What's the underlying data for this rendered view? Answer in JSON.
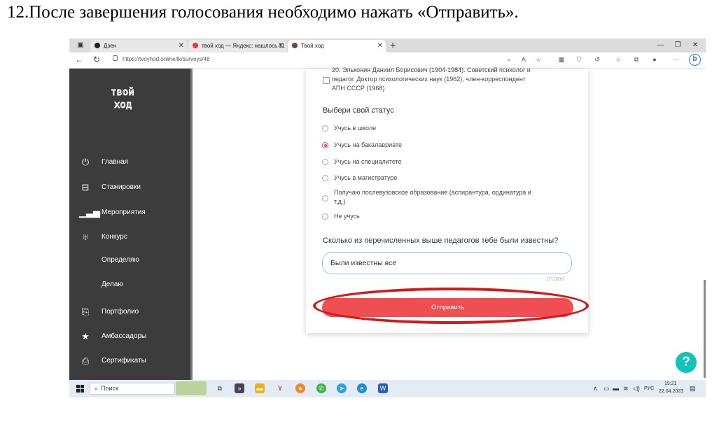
{
  "instruction": "12.После завершения голосования необходимо нажать «Отправить».",
  "browser": {
    "tabs": [
      {
        "title": "Дзен"
      },
      {
        "title": "твой ход — Яндекс: нашлось 11"
      },
      {
        "title": "Твой ход"
      }
    ],
    "url": "https://tvoyhod.online/lk/surveys/48"
  },
  "sidebar": {
    "logo_line1": "твой",
    "logo_line2": "ход",
    "items": [
      {
        "label": "Главная",
        "icon": "power-icon"
      },
      {
        "label": "Стажировки",
        "icon": "briefcase-icon"
      },
      {
        "label": "Мероприятия",
        "icon": "bars-icon"
      },
      {
        "label": "Конкурс",
        "icon": "trophy-icon"
      },
      {
        "label": "Определяю",
        "icon": ""
      },
      {
        "label": "Делаю",
        "icon": ""
      },
      {
        "label": "Портфолио",
        "icon": "portfolio-icon"
      },
      {
        "label": "Амбассадоры",
        "icon": "star-icon"
      },
      {
        "label": "Сертификаты",
        "icon": "certificate-icon"
      }
    ]
  },
  "survey": {
    "prev_option_line1": "20. Эльконин Даниил Борисович (1904-1984). Советский психолог и",
    "prev_option_line2": "педагог. Доктор психологических наук (1962), член-корреспондент",
    "prev_option_line3": "АПН СССР (1968)",
    "status_question": "Выбери свой статус",
    "status_options": [
      {
        "label": "Учусь в школе",
        "selected": false
      },
      {
        "label": "Учусь на бакалавриате",
        "selected": true
      },
      {
        "label": "Учусь на специалитете",
        "selected": false
      },
      {
        "label": "Учусь в магистратуре",
        "selected": false
      },
      {
        "label_line1": "Получаю послевузовское образование (аспирантура, ординатура и",
        "label_line2": "т.д.)",
        "selected": false
      },
      {
        "label": "Не учусь",
        "selected": false
      }
    ],
    "known_question": "Сколько из перечисленных выше педагогов тебе были известны?",
    "answer_value": "Были известны все",
    "char_counter": "17/1000",
    "submit_label": "Отправить"
  },
  "taskbar": {
    "search_label": "Поиск",
    "lang": "РУС",
    "time": "19:21",
    "date": "22.04.2023"
  },
  "colors": {
    "accent_red": "#ef4e52",
    "highlight_ellipse": "#d81818",
    "sidebar_bg": "#3c3c3c",
    "help_button": "#11c4b9"
  }
}
